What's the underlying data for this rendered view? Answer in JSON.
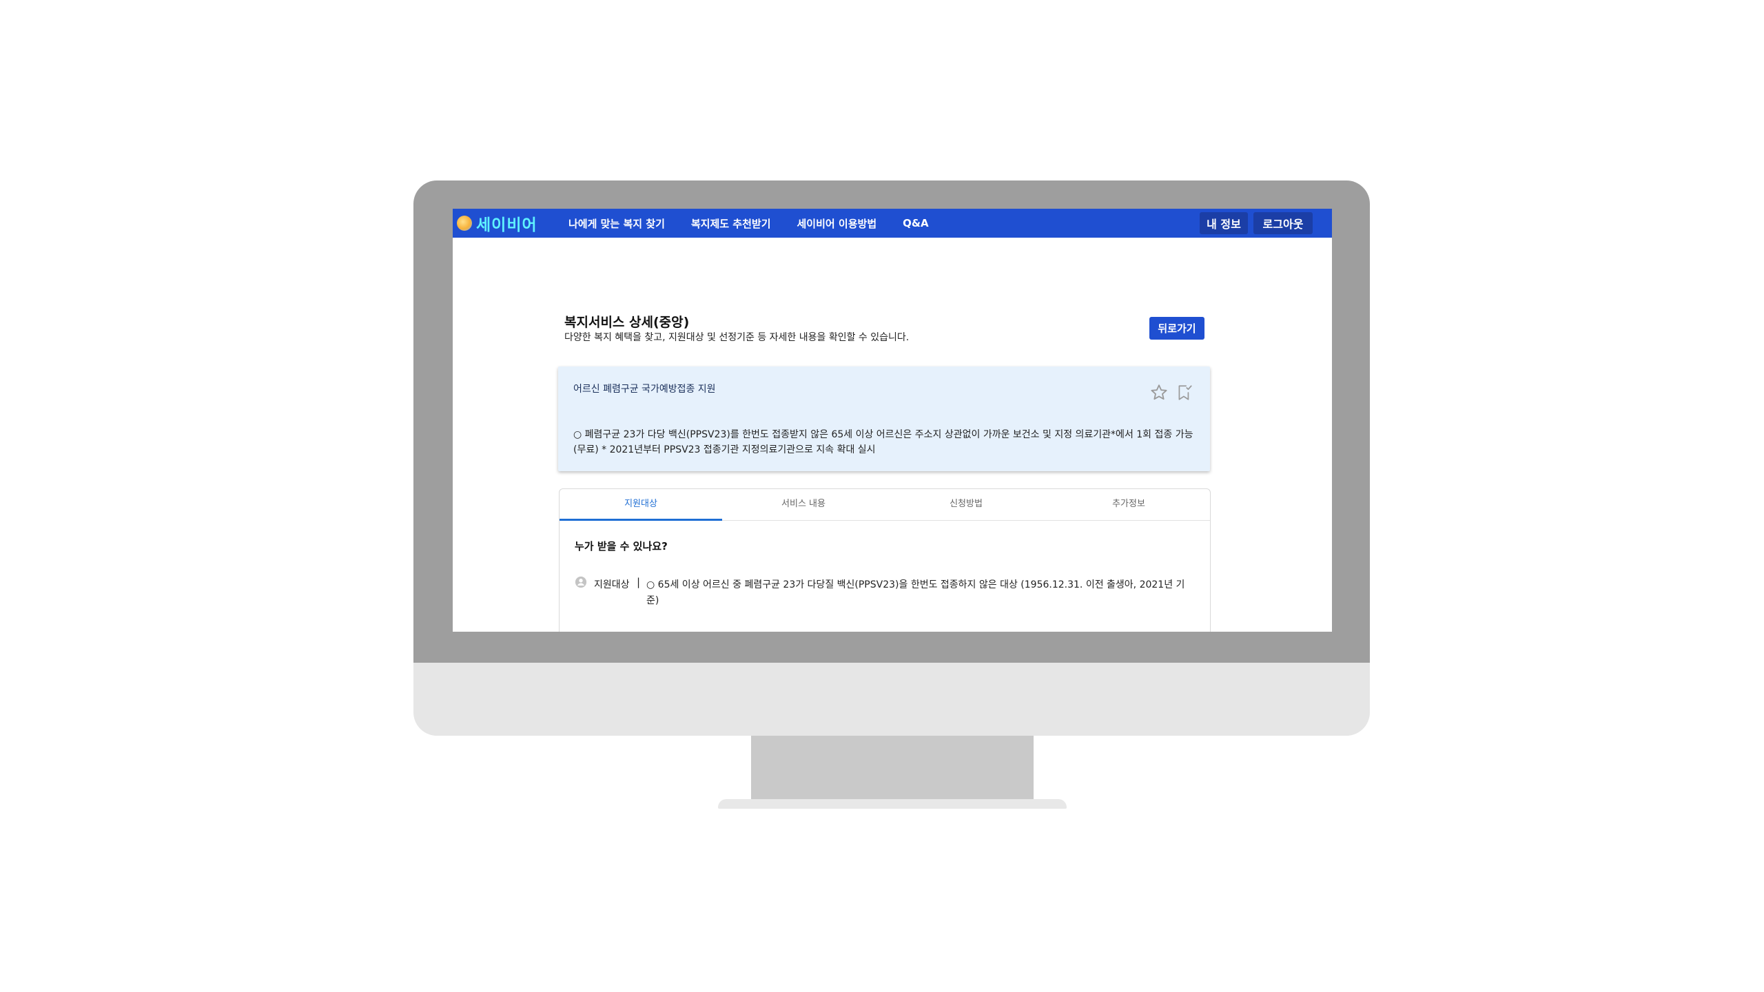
{
  "nav": {
    "logo_text": "세이비어",
    "menu": [
      "나에게 맞는 복지 찾기",
      "복지제도 추천받기",
      "세이비어 이용방법",
      "Q&A"
    ],
    "my_info": "내 정보",
    "logout": "로그아웃",
    "bg_color": "#1f4fd1"
  },
  "header": {
    "title": "복지서비스 상세(중앙)",
    "subtitle": "다양한 복지 혜택을 찾고, 지원대상 및 선정기준 등 자세한 내용을 확인할 수 있습니다.",
    "back_button": "뒤로가기"
  },
  "service": {
    "name": "어르신 폐렴구균 국가예방접종 지원",
    "description": "○ 폐렴구균 23가 다당 백신(PPSV23)를 한번도 접종받지 않은 65세 이상 어르신은 주소지 상관없이 가까운 보건소 및 지정 의료기관*에서 1회 접종 가능(무료) * 2021년부터 PPSV23 접종기관 지정의료기관으로 지속 확대 실시",
    "icons": [
      "star-icon",
      "bookmark-icon"
    ]
  },
  "tabs": {
    "items": [
      "지원대상",
      "서비스 내용",
      "신청방법",
      "추가정보"
    ],
    "active_index": 0
  },
  "eligibility": {
    "question": "누가 받을 수 있나요?",
    "label": "지원대상",
    "separator": "|",
    "text": "○ 65세 이상 어르신 중 폐렴구균 23가 다당질 백신(PPSV23)을 한번도 접종하지 않은 대상 (1956.12.31. 이전 출생아, 2021년 기준)"
  }
}
